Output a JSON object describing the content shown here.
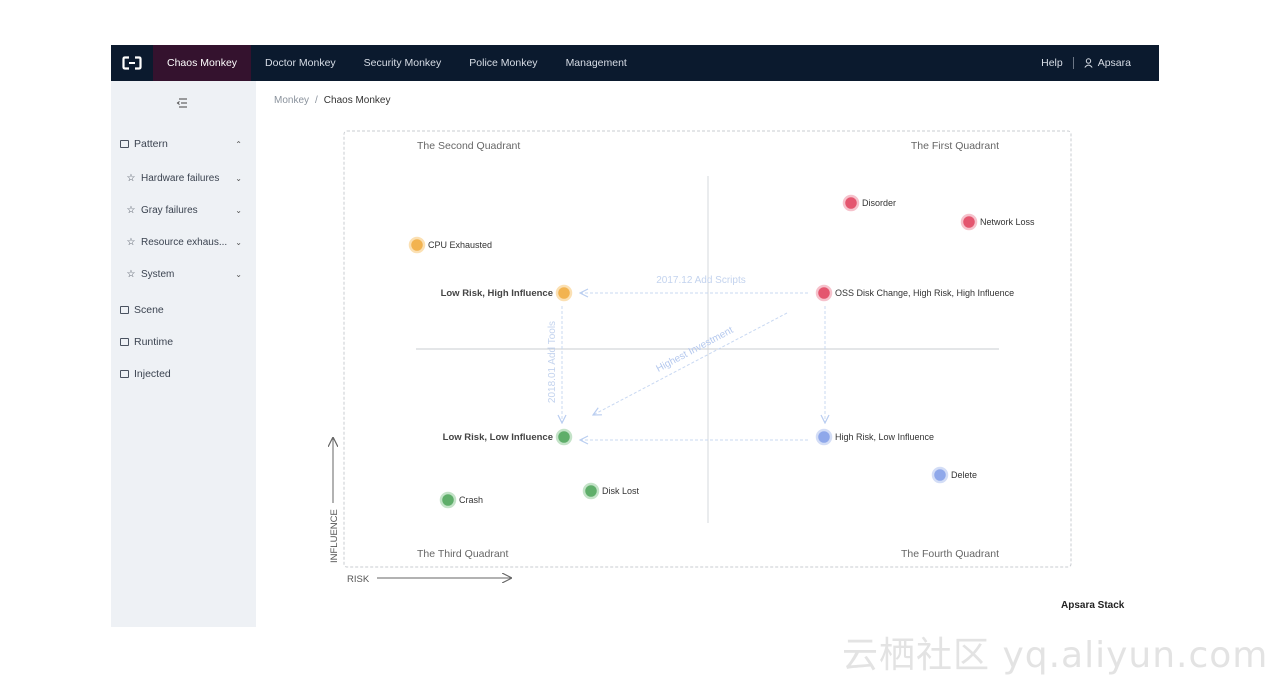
{
  "topbar": {
    "logo_icon": "aliyun-bracket-logo",
    "tabs": [
      {
        "label": "Chaos Monkey",
        "active": true
      },
      {
        "label": "Doctor Monkey",
        "active": false
      },
      {
        "label": "Security Monkey",
        "active": false
      },
      {
        "label": "Police Monkey",
        "active": false
      },
      {
        "label": "Management",
        "active": false
      }
    ],
    "help_label": "Help",
    "user_name": "Apsara",
    "colors": {
      "bar": "#0b1a2e",
      "active_tab": "#34122e"
    }
  },
  "sidebar": {
    "collapse_icon": "menu-collapse-icon",
    "items": [
      {
        "label": "Pattern",
        "icon": "monitor-icon",
        "chevron": "up"
      },
      {
        "label": "Hardware failures",
        "icon": "star-icon",
        "chevron": "down"
      },
      {
        "label": "Gray failures",
        "icon": "star-icon",
        "chevron": "down"
      },
      {
        "label": "Resource exhaus...",
        "icon": "star-icon",
        "chevron": "down"
      },
      {
        "label": "System",
        "icon": "star-icon",
        "chevron": "down"
      },
      {
        "label": "Scene",
        "icon": "monitor-icon"
      },
      {
        "label": "Runtime",
        "icon": "monitor-icon"
      },
      {
        "label": "Injected",
        "icon": "monitor-icon"
      }
    ]
  },
  "breadcrumb": {
    "root": "Monkey",
    "separator": "/",
    "current": "Chaos Monkey"
  },
  "quadrants": {
    "second": "The Second Quadrant",
    "first": "The First Quadrant",
    "third": "The Third Quadrant",
    "fourth": "The Fourth Quadrant"
  },
  "axes": {
    "influence": "INFLUENCE",
    "risk": "RISK"
  },
  "points": [
    {
      "label": "Disorder",
      "color": "#e4566f"
    },
    {
      "label": "Network Loss",
      "color": "#e4566f"
    },
    {
      "label": "CPU Exhausted",
      "color": "#f2b350"
    },
    {
      "label": "Low Risk, High Influence",
      "color": "#f2b350"
    },
    {
      "label": "OSS Disk Change, High Risk, High Influence",
      "color": "#e4566f"
    },
    {
      "label": "Low Risk, Low Influence",
      "color": "#5fae6a"
    },
    {
      "label": "High Risk, Low Influence",
      "color": "#8fa8ea"
    },
    {
      "label": "Delete",
      "color": "#8fa8ea"
    },
    {
      "label": "Disk Lost",
      "color": "#5fae6a"
    },
    {
      "label": "Crash",
      "color": "#5fae6a"
    }
  ],
  "annotations": {
    "scripts": "2017.12 Add Scripts",
    "tools": "2018.01 Add Tools",
    "investment": "Highest Investment"
  },
  "footer": {
    "brand": "Apsara Stack",
    "watermark": "云栖社区 yq.aliyun.com"
  }
}
